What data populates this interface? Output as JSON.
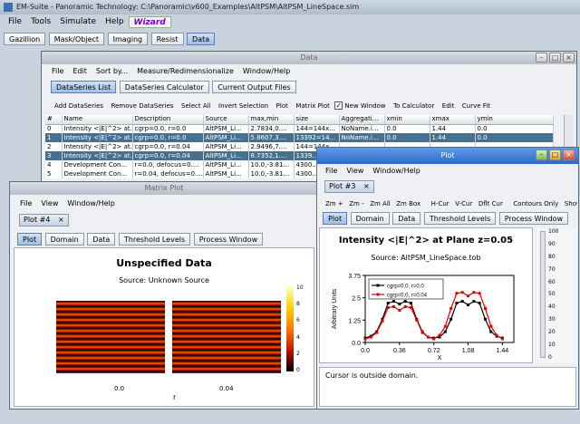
{
  "desktop": {
    "bg": "#5a86b8"
  },
  "main": {
    "title": "EM-Suite - Panoramic Technology: C:\\Panoramic\\v600_Examples\\AltPSM\\AltPSM_LineSpace.sim",
    "menu": [
      "File",
      "Tools",
      "Simulate",
      "Help"
    ],
    "wizard": "Wizard",
    "tabs": [
      "Gazillion",
      "Mask/Object",
      "Imaging",
      "Resist",
      "Data"
    ],
    "active_tab": "Data"
  },
  "data_win": {
    "title": "Data",
    "menu": [
      "File",
      "Edit",
      "Sort by...",
      "Measure/Redimensionalize",
      "Window/Help"
    ],
    "tabs": [
      "DataSeries List",
      "DataSeries Calculator",
      "Current Output Files"
    ],
    "toolbar": [
      "Add DataSeries",
      "Remove DataSeries",
      "Select All",
      "Invert Selection",
      "Plot",
      "Matrix Plot",
      "New Window",
      "To Calculator",
      "Edit",
      "Curve Fit"
    ],
    "new_window_checked": true,
    "columns": [
      "#",
      "Name",
      "Description",
      "Source",
      "max,min",
      "size",
      "Aggregati...",
      "xmin",
      "xmax",
      "ymin"
    ],
    "rows": [
      [
        "0",
        "Intensity <|E|^2> at...",
        "cgrp=0.0, r=0.0",
        "AltPSM_Li...",
        "2.7834,0....",
        "144=144x...",
        "NoName.i...",
        "0.0",
        "1.44",
        "0.0"
      ],
      [
        "1",
        "Intensity <|E|^2> at...",
        "cgrp=0.0, r=0.0",
        "AltPSM_Li...",
        "5.8607,3....",
        "13392=14...",
        "NoName.i...",
        "0.0",
        "1.44",
        "0.0"
      ],
      [
        "2",
        "Intensity <|E|^2> at...",
        "cgrp=0.0, r=0.04",
        "AltPSM_Li...",
        "2.9496,7....",
        "144=144x...",
        "",
        "",
        "",
        ""
      ],
      [
        "3",
        "Intensity <|E|^2> at...",
        "cgrp=0.0, r=0.04",
        "AltPSM_Li...",
        "8.7352,1....",
        "1339...",
        "",
        "",
        "",
        ""
      ],
      [
        "4",
        "Development Con...",
        "r=0.0, defocus=0....",
        "AltPSM_Li...",
        "10.0,-3.81...",
        "4300...",
        "",
        "",
        "",
        ""
      ],
      [
        "5",
        "Development Con...",
        "r=0.04, defocus=0....",
        "AltPSM_Li...",
        "10.0,-3.81...",
        "4300...",
        "",
        "",
        "",
        ""
      ]
    ],
    "selected_rows": [
      1,
      3
    ]
  },
  "matrix_win": {
    "title": "Matrix Plot",
    "menu": [
      "File",
      "View",
      "Window/Help"
    ],
    "doc_tab": "Plot #4",
    "tabs": [
      "Plot",
      "Domain",
      "Data",
      "Threshold Levels",
      "Process Window"
    ],
    "heading": "Unspecified Data",
    "source": "Source: Unknown Source",
    "xticks": [
      "0.0",
      "0.04"
    ],
    "xlabel": "r",
    "colorbar_ticks": [
      "10",
      "8",
      "6",
      "4",
      "2",
      "0"
    ]
  },
  "plot_win": {
    "title": "Plot",
    "menu": [
      "File",
      "View",
      "Window/Help"
    ],
    "doc_tab": "Plot #3",
    "toolbar": [
      "Zm +",
      "Zm -",
      "Zm All",
      "Zm Box",
      "H-Cur",
      "V-Cur",
      "Dflt Cur",
      "Contours Only",
      "Show Ima"
    ],
    "tabs": [
      "Plot",
      "Domain",
      "Data",
      "Threshold Levels",
      "Process Window"
    ],
    "status": "Cursor is outside domain.",
    "side_ticks": [
      "100",
      "90",
      "80",
      "70",
      "60",
      "50",
      "40",
      "30",
      "20",
      "10",
      "0"
    ]
  },
  "chart_data": {
    "type": "line",
    "title": "Intensity <|E|^2> at Plane z=0.05",
    "subtitle": "Source: AltPSM_LineSpace.tob",
    "xlabel": "X",
    "ylabel": "Arbitrary Units",
    "xlim": [
      0,
      1.56
    ],
    "ylim": [
      0,
      3.75
    ],
    "xticks": [
      "0.0",
      "0.36",
      "0.72",
      "1.08",
      "1.44"
    ],
    "yticks": [
      "0.0",
      "1.25",
      "2.5",
      "3.75"
    ],
    "x": [
      0,
      0.06,
      0.12,
      0.18,
      0.24,
      0.3,
      0.36,
      0.42,
      0.48,
      0.54,
      0.6,
      0.66,
      0.72,
      0.78,
      0.84,
      0.9,
      0.96,
      1.02,
      1.08,
      1.14,
      1.2,
      1.26,
      1.32,
      1.38,
      1.44
    ],
    "series": [
      {
        "name": "cgrp=0.0, r=0.0",
        "color": "#000000",
        "values": [
          0.25,
          0.35,
          0.6,
          1.3,
          2.2,
          2.3,
          2.15,
          2.3,
          2.2,
          1.3,
          0.6,
          0.3,
          0.25,
          0.3,
          0.6,
          1.3,
          2.2,
          2.3,
          2.1,
          2.3,
          2.2,
          1.3,
          0.6,
          0.35,
          0.25
        ]
      },
      {
        "name": "cgrp=0.0, r=0.04",
        "color": "#e00000",
        "values": [
          0.2,
          0.3,
          0.55,
          1.2,
          1.95,
          2.0,
          1.8,
          2.0,
          1.95,
          1.25,
          0.55,
          0.3,
          0.2,
          0.4,
          0.9,
          1.9,
          2.75,
          2.8,
          2.6,
          2.8,
          2.75,
          1.9,
          0.9,
          0.4,
          0.2
        ]
      }
    ]
  }
}
